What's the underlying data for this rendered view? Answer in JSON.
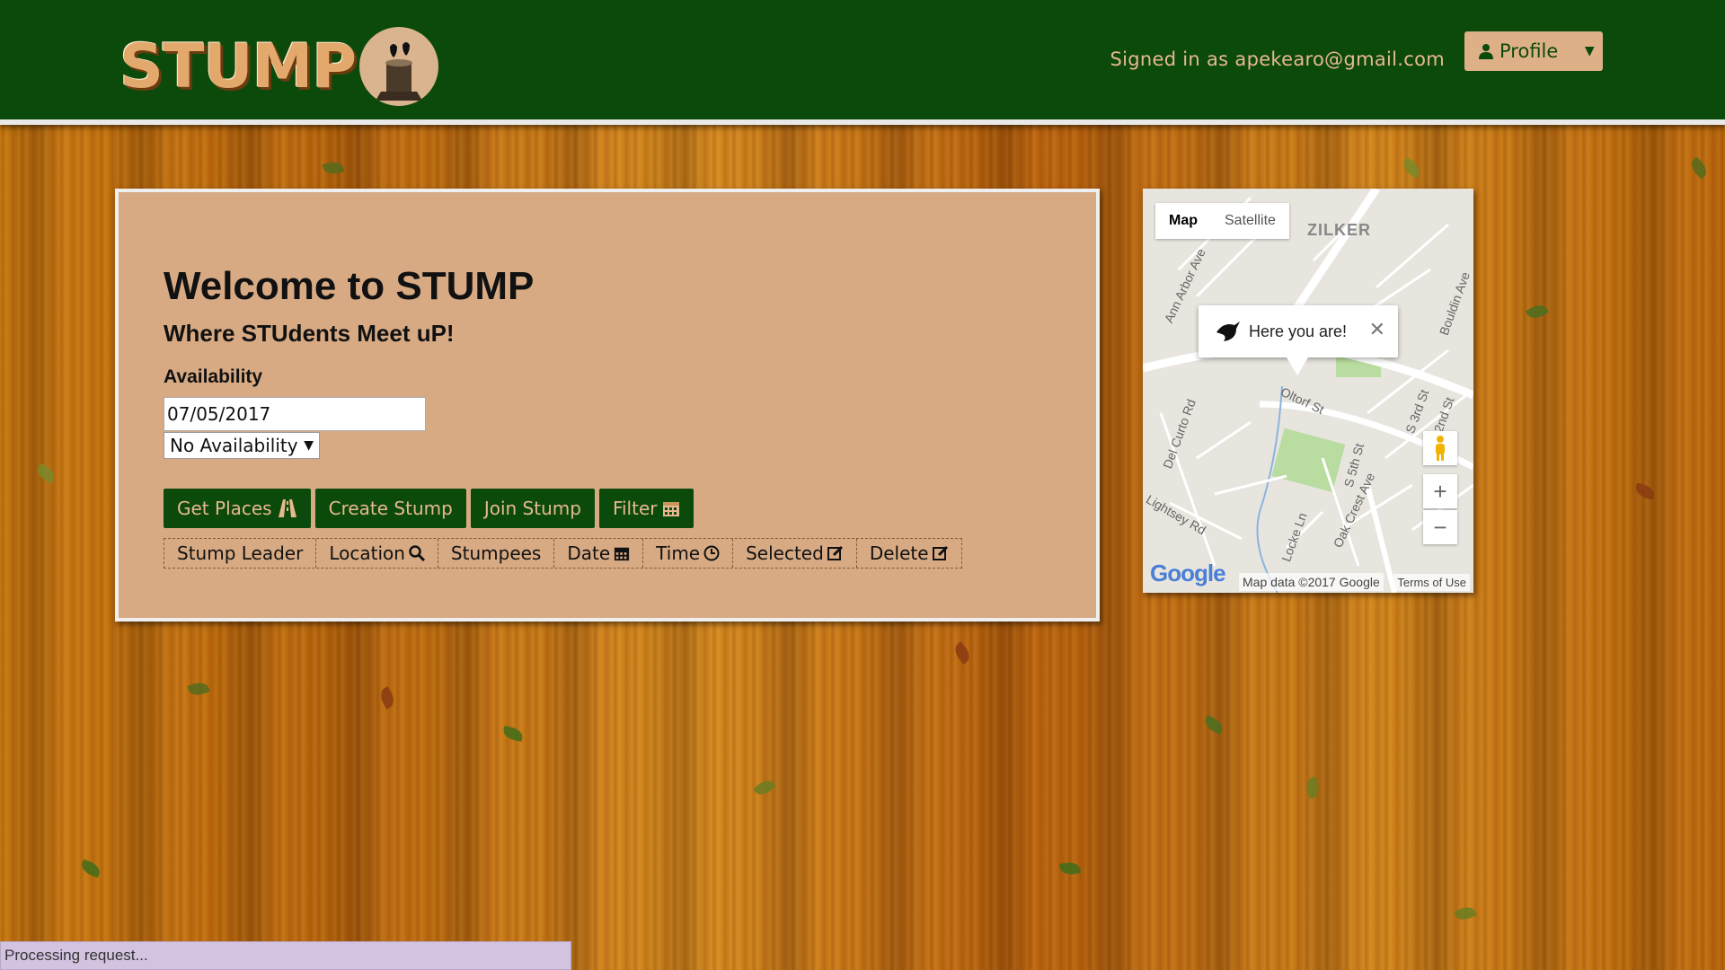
{
  "header": {
    "logo_text": "STUMP",
    "signed_in_text": "Signed in as apekearo@gmail.com",
    "profile_label": "Profile"
  },
  "main": {
    "title": "Welcome to STUMP",
    "subtitle": "Where STUdents Meet uP!",
    "availability_label": "Availability",
    "date_value": "07/05/2017",
    "availability_selected": "No Availability",
    "buttons": {
      "get_places": "Get Places",
      "create_stump": "Create Stump",
      "join_stump": "Join Stump",
      "filter": "Filter"
    },
    "table_columns": [
      "Stump Leader",
      "Location",
      "Stumpees",
      "Date",
      "Time",
      "Selected",
      "Delete"
    ]
  },
  "map": {
    "type_map": "Map",
    "type_satellite": "Satellite",
    "area_label": "ZILKER",
    "info_window_text": "Here you are!",
    "zoom_in": "+",
    "zoom_out": "−",
    "google_logo": "Google",
    "map_data": "Map data ©2017 Google",
    "terms": "Terms of Use",
    "streets": [
      "Ann Arbor Ave",
      "Del Curto Rd",
      "Lightsey Rd",
      "Locke Ln",
      "Oak Crest Ave",
      "S 5th St",
      "S 3rd St",
      "S 2nd St",
      "Bouldin Ave",
      "Oltorf St"
    ]
  },
  "status": {
    "text": "Processing request..."
  },
  "colors": {
    "header_green": "#0c4a0b",
    "card_tan": "#d7aa84",
    "button_text": "#e7b890",
    "status_bar": "#d3c3e0"
  }
}
